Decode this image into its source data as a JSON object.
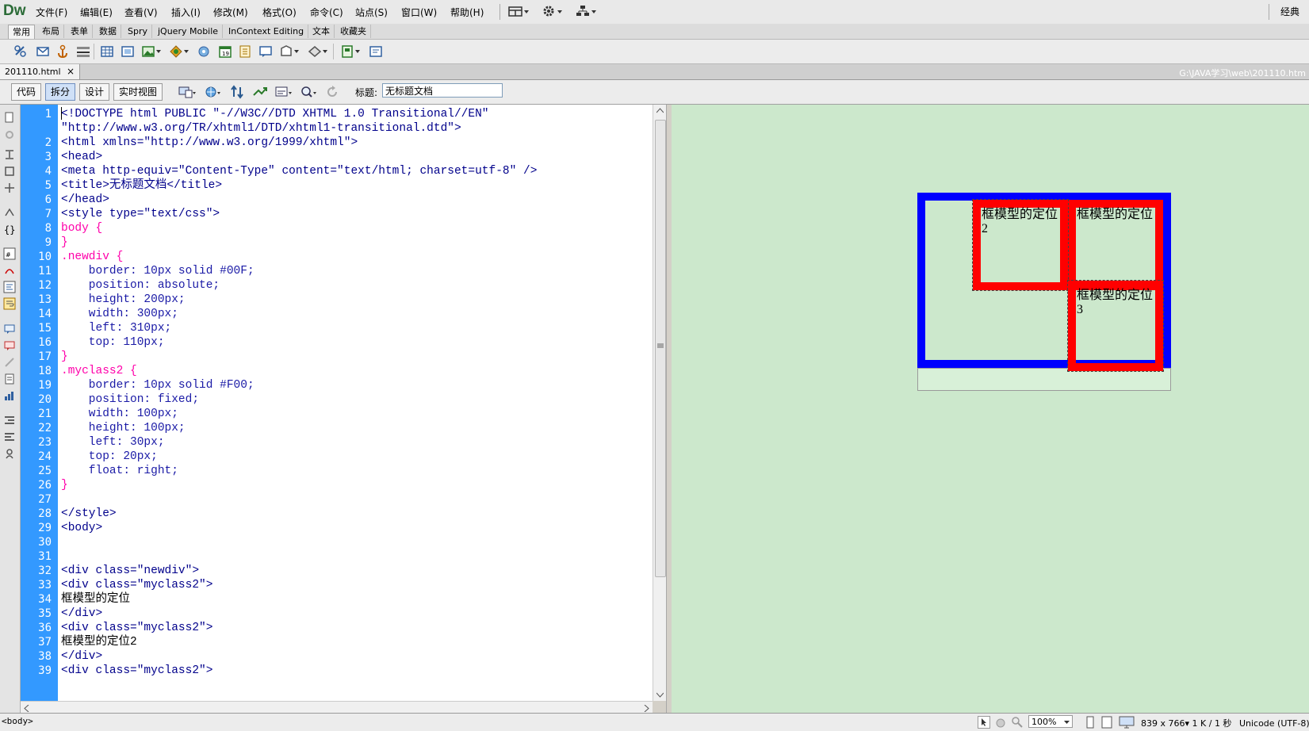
{
  "app": {
    "logo": "Dw",
    "workspace": "经典"
  },
  "menus": [
    "文件(F)",
    "编辑(E)",
    "查看(V)",
    "插入(I)",
    "修改(M)",
    "格式(O)",
    "命令(C)",
    "站点(S)",
    "窗口(W)",
    "帮助(H)"
  ],
  "insert_tabs": [
    "常用",
    "布局",
    "表单",
    "数据",
    "Spry",
    "jQuery Mobile",
    "InContext Editing",
    "文本",
    "收藏夹"
  ],
  "document": {
    "tab_name": "201110.html",
    "close_glyph": "×",
    "path": "G:\\JAVA学习\\web\\201110.htm"
  },
  "view_buttons": [
    "代码",
    "拆分",
    "设计",
    "实时视图"
  ],
  "title_field": {
    "label": "标题:",
    "value": "无标题文档"
  },
  "code_lines": [
    {
      "n": "1",
      "t": "<!DOCTYPE html PUBLIC \"-//W3C//DTD XHTML 1.0 Transitional//EN\"",
      "k": "tag"
    },
    {
      "n": "",
      "t": "\"http://www.w3.org/TR/xhtml1/DTD/xhtml1-transitional.dtd\">",
      "k": "tag"
    },
    {
      "n": "2",
      "t": "<html xmlns=\"http://www.w3.org/1999/xhtml\">",
      "k": "tag"
    },
    {
      "n": "3",
      "t": "<head>",
      "k": "tag"
    },
    {
      "n": "4",
      "t": "<meta http-equiv=\"Content-Type\" content=\"text/html; charset=utf-8\" />",
      "k": "tag"
    },
    {
      "n": "5",
      "t": "<title>无标题文档</title>",
      "k": "tag"
    },
    {
      "n": "6",
      "t": "</head>",
      "k": "tag"
    },
    {
      "n": "7",
      "t": "<style type=\"text/css\">",
      "k": "tag"
    },
    {
      "n": "8",
      "t": "body {",
      "k": "sel"
    },
    {
      "n": "9",
      "t": "}",
      "k": "sel"
    },
    {
      "n": "10",
      "t": ".newdiv {",
      "k": "sel"
    },
    {
      "n": "11",
      "t": "    border: 10px solid #00F;",
      "k": "prop"
    },
    {
      "n": "12",
      "t": "    position: absolute;",
      "k": "prop"
    },
    {
      "n": "13",
      "t": "    height: 200px;",
      "k": "prop"
    },
    {
      "n": "14",
      "t": "    width: 300px;",
      "k": "prop"
    },
    {
      "n": "15",
      "t": "    left: 310px;",
      "k": "prop"
    },
    {
      "n": "16",
      "t": "    top: 110px;",
      "k": "prop"
    },
    {
      "n": "17",
      "t": "}",
      "k": "sel"
    },
    {
      "n": "18",
      "t": ".myclass2 {",
      "k": "sel"
    },
    {
      "n": "19",
      "t": "    border: 10px solid #F00;",
      "k": "prop"
    },
    {
      "n": "20",
      "t": "    position: fixed;",
      "k": "prop"
    },
    {
      "n": "21",
      "t": "    width: 100px;",
      "k": "prop"
    },
    {
      "n": "22",
      "t": "    height: 100px;",
      "k": "prop"
    },
    {
      "n": "23",
      "t": "    left: 30px;",
      "k": "prop"
    },
    {
      "n": "24",
      "t": "    top: 20px;",
      "k": "prop"
    },
    {
      "n": "25",
      "t": "    float: right;",
      "k": "prop"
    },
    {
      "n": "26",
      "t": "}",
      "k": "sel"
    },
    {
      "n": "27",
      "t": "",
      "k": "text"
    },
    {
      "n": "28",
      "t": "</style>",
      "k": "tag"
    },
    {
      "n": "29",
      "t": "<body>",
      "k": "tag"
    },
    {
      "n": "30",
      "t": "",
      "k": "text"
    },
    {
      "n": "31",
      "t": "",
      "k": "text"
    },
    {
      "n": "32",
      "t": "<div class=\"newdiv\">",
      "k": "tag"
    },
    {
      "n": "33",
      "t": "<div class=\"myclass2\">",
      "k": "tag"
    },
    {
      "n": "34",
      "t": "框模型的定位",
      "k": "text"
    },
    {
      "n": "35",
      "t": "</div>",
      "k": "tag"
    },
    {
      "n": "36",
      "t": "<div class=\"myclass2\">",
      "k": "tag"
    },
    {
      "n": "37",
      "t": "框模型的定位2",
      "k": "text"
    },
    {
      "n": "38",
      "t": "</div>",
      "k": "tag"
    },
    {
      "n": "39",
      "t": "<div class=\"myclass2\">",
      "k": "tag"
    }
  ],
  "design_view": {
    "box1_text": "框模型的定位",
    "box2_text": "框模型的定位2",
    "box3_text": "框模型的定位3",
    "outer_border_color": "#0000ff",
    "inner_border_color": "#ff0000"
  },
  "status": {
    "tag_selector": "<body>",
    "zoom": "100%",
    "dimensions": "839 x 766",
    "filesize": "1 K / 1 秒",
    "encoding": "Unicode (UTF-8)"
  }
}
